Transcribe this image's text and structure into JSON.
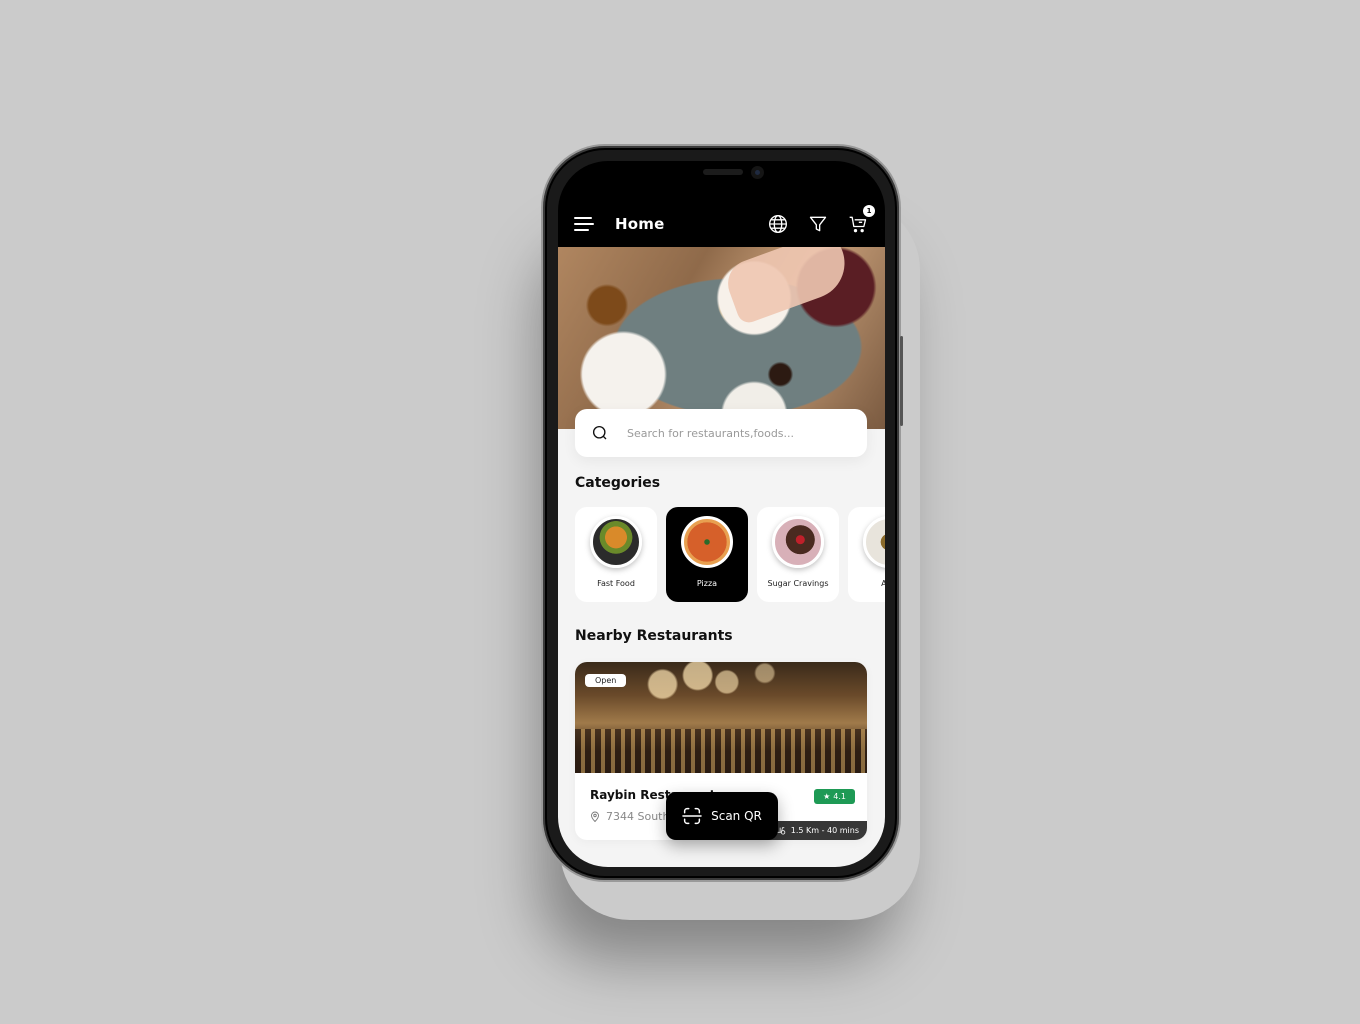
{
  "appbar": {
    "title": "Home",
    "menu_icon": "hamburger-menu-icon",
    "actions": [
      {
        "icon": "globe-icon",
        "label": "Language"
      },
      {
        "icon": "filter-icon",
        "label": "Filter"
      },
      {
        "icon": "cart-icon",
        "label": "Cart",
        "badge": "1"
      }
    ]
  },
  "search": {
    "placeholder": "Search for restaurants,foods..."
  },
  "categories": {
    "title": "Categories",
    "items": [
      {
        "label": "Fast Food",
        "active": false
      },
      {
        "label": "Pizza",
        "active": true
      },
      {
        "label": "Sugar Cravings",
        "active": false
      },
      {
        "label": "App",
        "active": false
      }
    ]
  },
  "nearby": {
    "title": "Nearby Restaurants",
    "restaurants": [
      {
        "status": "Open",
        "distance": "1.5 Km - 40 mins",
        "name": "Raybin Restaurant",
        "address": "7344 South",
        "rating": "4.1"
      }
    ]
  },
  "scan_button": {
    "label": "Scan QR"
  },
  "colors": {
    "background": "#cbcbcb",
    "accent": "#000000",
    "rating_green": "#1e9a55"
  }
}
